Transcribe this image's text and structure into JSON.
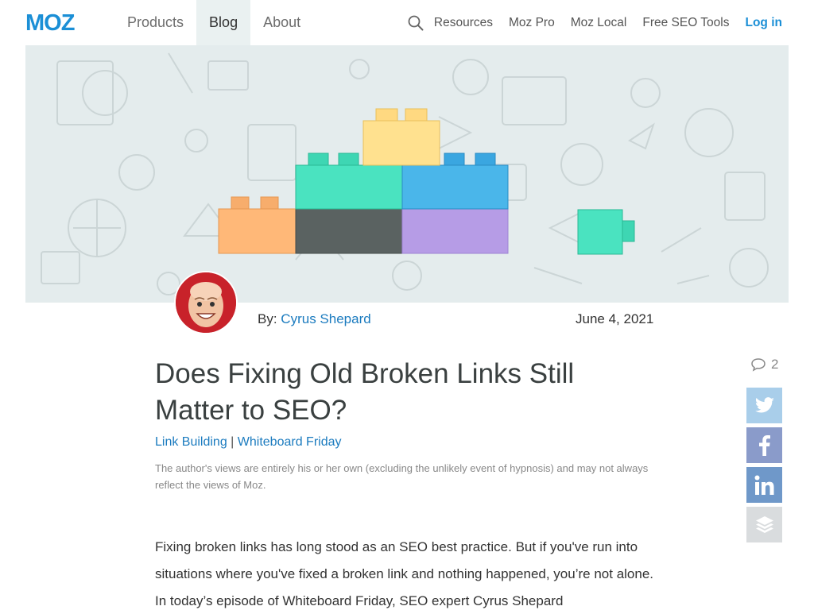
{
  "nav": {
    "logo": "MOZ",
    "left_links": [
      "Products",
      "Blog",
      "About"
    ],
    "active_link": "Blog",
    "right_links": [
      "Resources",
      "Moz Pro",
      "Moz Local",
      "Free SEO Tools"
    ],
    "login": "Log in",
    "search_icon": "search-icon"
  },
  "byline": {
    "prefix": "By: ",
    "author": "Cyrus Shepard",
    "date": "June 4, 2021"
  },
  "article": {
    "title": "Does Fixing Old Broken Links Still Matter to SEO?",
    "categories": [
      "Link Building",
      "Whiteboard Friday"
    ],
    "category_separator": " | ",
    "disclaimer": "The author's views are entirely his or her own (excluding the unlikely event of hypnosis) and may not always reflect the views of Moz.",
    "body": "Fixing broken links has long stood as an SEO best practice. But if you've run into situations where you've fixed a broken link and nothing happened, you’re not alone. In today’s episode of Whiteboard Friday, SEO expert Cyrus Shepard"
  },
  "share": {
    "comment_count": "2",
    "comment_icon": "comment-icon",
    "buttons": [
      "twitter-icon",
      "facebook-icon",
      "linkedin-icon",
      "buffer-icon"
    ]
  },
  "colors": {
    "brand_blue": "#1b8fd6",
    "link_blue": "#1b7bbf",
    "hero_bg": "#e4eced",
    "twitter": "#a9ceea",
    "facebook": "#8a9bca",
    "linkedin": "#6f98c9",
    "buffer": "#d9dcde"
  }
}
